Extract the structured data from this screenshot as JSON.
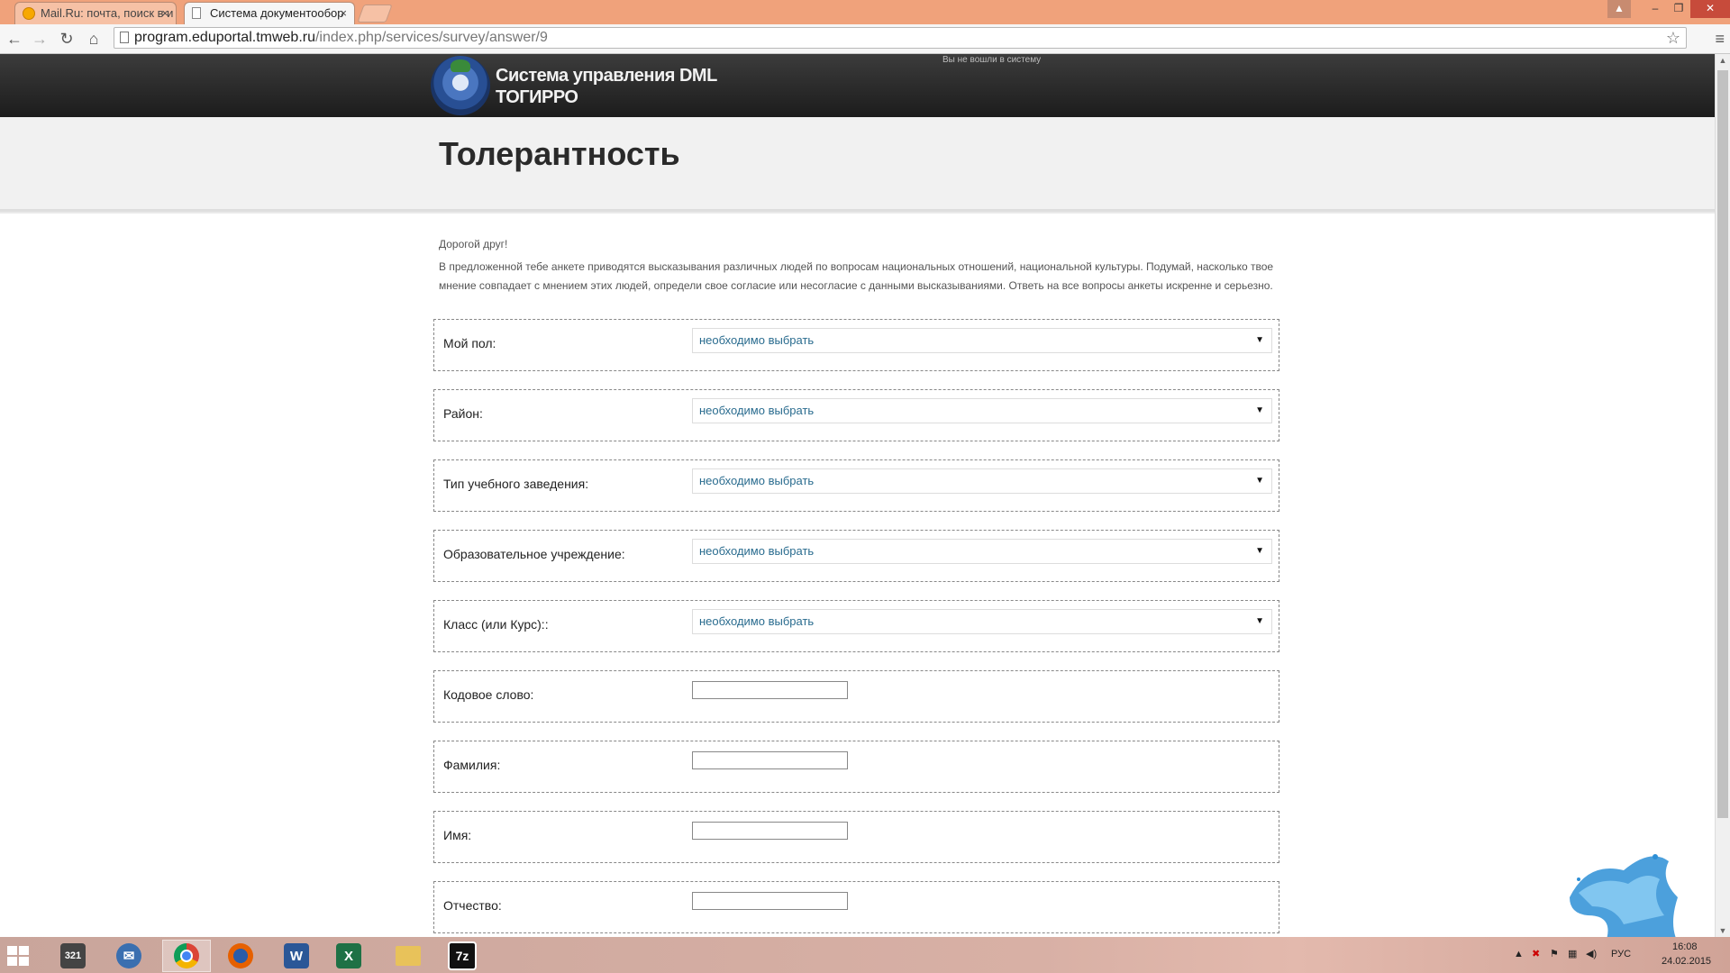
{
  "browser": {
    "tabs": [
      {
        "label": "Mail.Ru: почта, поиск в и",
        "active": false
      },
      {
        "label": "Система документообор",
        "active": true
      }
    ],
    "close_glyph": "×",
    "url_host": "program.eduportal.tmweb.ru",
    "url_path": "/index.php/services/survey/answer/9"
  },
  "site": {
    "title_line1": "Система управления DML",
    "title_line2": "ТОГИРРО",
    "login_status": "Вы не вошли в систему"
  },
  "page": {
    "title": "Толерантность",
    "greeting": "Дорогой друг!",
    "intro": "В предложенной тебе анкете приводятся высказывания различных людей по вопросам национальных отношений, национальной культуры. Подумай, насколько твое мнение совпадает с мнением этих людей, определи свое согласие или несогласие с данными высказываниями. Ответь на все вопросы анкеты искренне и серьезно."
  },
  "form": {
    "select_placeholder": "необходимо выбрать",
    "fields": [
      {
        "label": "Мой пол:"
      },
      {
        "label": "Район:"
      },
      {
        "label": "Тип учебного заведения:"
      },
      {
        "label": "Образовательное учреждение:"
      },
      {
        "label": "Класс (или Курс)::"
      },
      {
        "label": "Кодовое слово:"
      },
      {
        "label": "Фамилия:"
      },
      {
        "label": "Имя:"
      },
      {
        "label": "Отчество:"
      }
    ]
  },
  "taskbar": {
    "apps": [
      "media-player-classic",
      "thunderbird",
      "chrome",
      "firefox",
      "word",
      "excel",
      "file-explorer",
      "7zip"
    ],
    "lang": "РУС",
    "time": "16:08",
    "date": "24.02.2015"
  },
  "colors": {
    "titlebar": "#f0a27b",
    "header_bg": "#2b2b2b",
    "select_text": "#2a6c8f"
  }
}
